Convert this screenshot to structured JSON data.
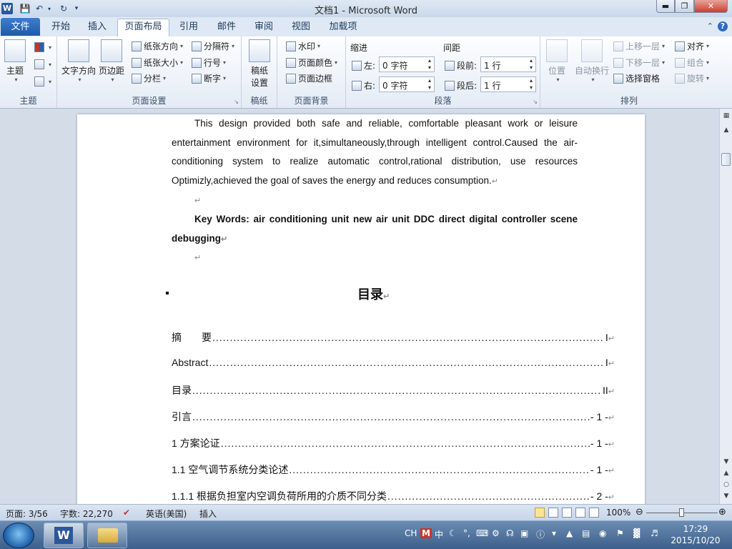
{
  "window": {
    "title": "文档1 - Microsoft Word",
    "app_icon": "W"
  },
  "qat": {
    "save": "save-icon",
    "undo": "undo-icon",
    "redo": "redo-icon"
  },
  "tabs": {
    "file": "文件",
    "items": [
      "开始",
      "插入",
      "页面布局",
      "引用",
      "邮件",
      "审阅",
      "视图",
      "加载项"
    ],
    "active": "页面布局"
  },
  "ribbon": {
    "theme": {
      "label": "主题",
      "group": "主题"
    },
    "page_setup": {
      "group": "页面设置",
      "text_direction": "文字方向",
      "margins": "页边距",
      "orientation": "纸张方向",
      "size": "纸张大小",
      "columns": "分栏",
      "breaks": "分隔符",
      "line_numbers": "行号",
      "hyphenation": "断字"
    },
    "draft": {
      "group": "稿纸",
      "button": "稿纸\n设置"
    },
    "page_bg": {
      "group": "页面背景",
      "watermark": "水印",
      "page_color": "页面颜色",
      "page_border": "页面边框"
    },
    "paragraph": {
      "group": "段落",
      "indent": "缩进",
      "spacing": "间距",
      "left_label": "左:",
      "right_label": "右:",
      "before_label": "段前:",
      "after_label": "段后:",
      "left_value": "0 字符",
      "right_value": "0 字符",
      "before_value": "1 行",
      "after_value": "1 行"
    },
    "arrange": {
      "group": "排列",
      "position": "位置",
      "wrap": "自动换行",
      "bring_forward": "上移一层",
      "send_backward": "下移一层",
      "selection_pane": "选择窗格",
      "align": "对齐",
      "group_btn": "组合",
      "rotate": "旋转"
    }
  },
  "document": {
    "abstract": "This design provided both safe and reliable, comfortable pleasant work or leisure entertainment environment for it,simultaneously,through intelligent control.Caused the air-conditioning system to realize automatic control,rational distribution, use resources Optimizly,achieved the goal of saves the energy and reduces consumption.",
    "keywords_label": "Key Words:",
    "keywords": " air conditioning unit    new air unit    DDC      direct digital controller scene debugging",
    "toc_title": "目录",
    "toc": [
      {
        "label": "摘　　要",
        "page": "I"
      },
      {
        "label": "Abstract",
        "page": "I"
      },
      {
        "label": "目录",
        "page": "II"
      },
      {
        "label": "引言",
        "page": "- 1 -"
      },
      {
        "label": "1  方案论证",
        "page": "- 1 -"
      },
      {
        "label": "1.1    空气调节系统分类论述",
        "page": "- 1 -"
      },
      {
        "label": "1.1.1    根据负担室内空调负荷所用的介质不同分类",
        "page": "- 2 -"
      }
    ]
  },
  "status": {
    "page": "页面: 3/56",
    "words": "字数: 22,270",
    "language": "英语(美国)",
    "mode": "插入",
    "zoom": "100%",
    "zoom_level": 1.0
  },
  "taskbar": {
    "ime": "CH",
    "time": "17:29",
    "date": "2015/10/20",
    "ime_char": "中"
  }
}
